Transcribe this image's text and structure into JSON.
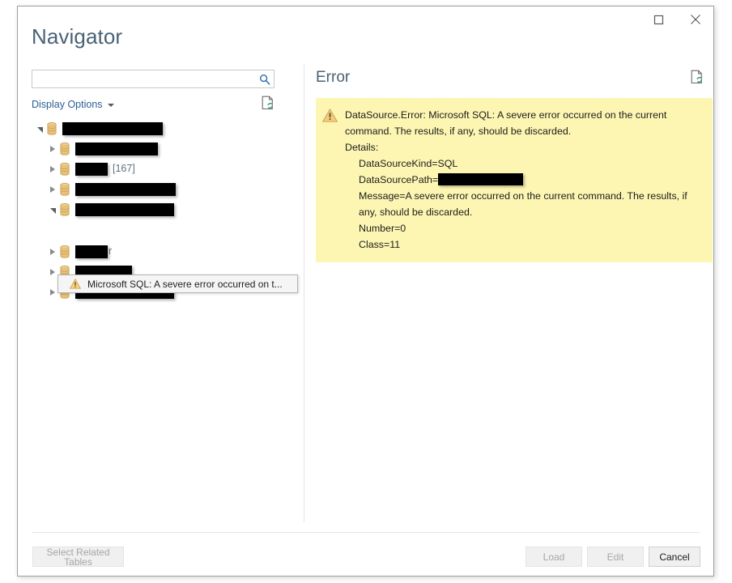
{
  "window": {
    "title": "Navigator",
    "controls": [
      {
        "name": "maximize",
        "label": "Maximize"
      },
      {
        "name": "close",
        "label": "Close"
      }
    ]
  },
  "left_pane": {
    "search": {
      "value": "",
      "placeholder": "",
      "icon": "search-icon"
    },
    "display_options": {
      "label": "Display Options",
      "caret": "chevron-down-icon"
    },
    "refresh_icon": "refresh-document-icon",
    "tree": [
      {
        "level": 1,
        "expander": "expanded",
        "icon": "database-icon",
        "redact_width": 124,
        "extra": ""
      },
      {
        "level": 2,
        "expander": "collapsed",
        "icon": "database-icon",
        "redact_width": 102,
        "extra": ""
      },
      {
        "level": 2,
        "expander": "collapsed",
        "icon": "database-icon",
        "redact_width": 40,
        "extra": "[167]"
      },
      {
        "level": 2,
        "expander": "collapsed",
        "icon": "database-icon",
        "redact_width": 124,
        "extra": ""
      },
      {
        "level": 2,
        "expander": "expanded",
        "icon": "database-icon",
        "redact_width": 122,
        "extra": ""
      },
      {
        "level": 2,
        "expander": "collapsed",
        "icon": "database-icon",
        "redact_width": 40,
        "extra": "r"
      },
      {
        "level": 2,
        "expander": "collapsed",
        "icon": "database-icon",
        "redact_width": 70,
        "extra": ""
      },
      {
        "level": 2,
        "expander": "collapsed",
        "icon": "database-icon",
        "redact_width": 122,
        "extra": ""
      }
    ],
    "tooltip": {
      "icon": "warning-icon",
      "text": "Microsoft SQL: A severe error occurred on t..."
    }
  },
  "right_pane": {
    "title": "Error",
    "refresh_icon": "refresh-document-icon",
    "warning_icon": "warning-icon",
    "error_lines": [
      {
        "text": "DataSource.Error: Microsoft SQL: A severe error occurred on the current command.  The results, if any, should be discarded.",
        "indent": false
      },
      {
        "text": "Details:",
        "indent": false
      },
      {
        "text": "DataSourceKind=SQL",
        "indent": true
      },
      {
        "text": "DataSourcePath=",
        "indent": true,
        "redact_width": 105
      },
      {
        "text": "Message=A severe error occurred on the current command.  The results, if any, should be discarded.",
        "indent": true
      },
      {
        "text": "Number=0",
        "indent": true
      },
      {
        "text": "Class=11",
        "indent": true
      }
    ]
  },
  "footer": {
    "select_related_tables": "Select Related Tables",
    "load": "Load",
    "edit": "Edit",
    "cancel": "Cancel"
  },
  "colors": {
    "title": "#4a6275",
    "link": "#2b5e93",
    "error_background": "#fdf6b2",
    "warning": "#e0a83c",
    "database_icon": "#e8c177",
    "redaction": "#000000"
  }
}
